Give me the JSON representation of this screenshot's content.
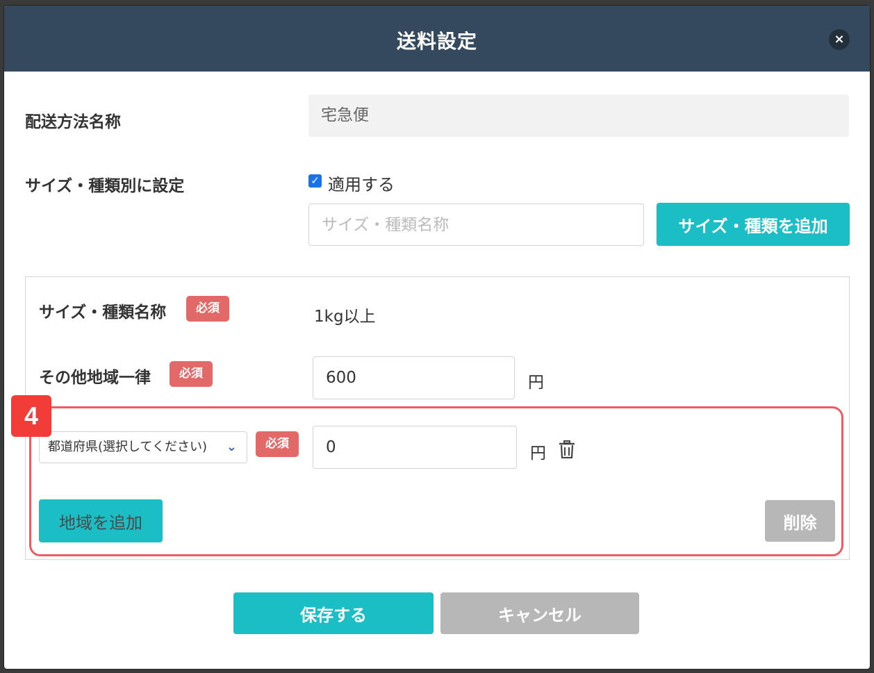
{
  "modal": {
    "title": "送料設定",
    "close_symbol": "×"
  },
  "shipping_method": {
    "label": "配送方法名称",
    "value": "宅急便"
  },
  "size_type_setting": {
    "label": "サイズ・種類別に設定",
    "checkbox_label": "適用する",
    "checked": true,
    "name_placeholder": "サイズ・種類名称",
    "add_button": "サイズ・種類を追加"
  },
  "size_panel": {
    "name_label": "サイズ・種類名称",
    "name_required": "必須",
    "name_value": "1kg以上",
    "other_region_label": "その他地域一律",
    "other_region_required": "必須",
    "other_region_value": "600",
    "other_region_unit": "円",
    "prefecture_select": "都道府県(選択してください)",
    "prefecture_required": "必須",
    "prefecture_value": "0",
    "prefecture_unit": "円",
    "add_region_button": "地域を追加",
    "delete_button": "削除"
  },
  "annotation": {
    "step_number": "4",
    "accent_color": "#ef5b63"
  },
  "footer": {
    "save_button": "保存する",
    "cancel_button": "キャンセル"
  },
  "colors": {
    "header_bg": "#34495e",
    "teal": "#1cbec6",
    "gray": "#b7b7b7",
    "required_badge": "#e36868"
  },
  "icons": {
    "close": "close-icon",
    "checkbox": "checkmark-icon",
    "chevron": "chevron-down-icon",
    "trash": "trash-icon"
  }
}
